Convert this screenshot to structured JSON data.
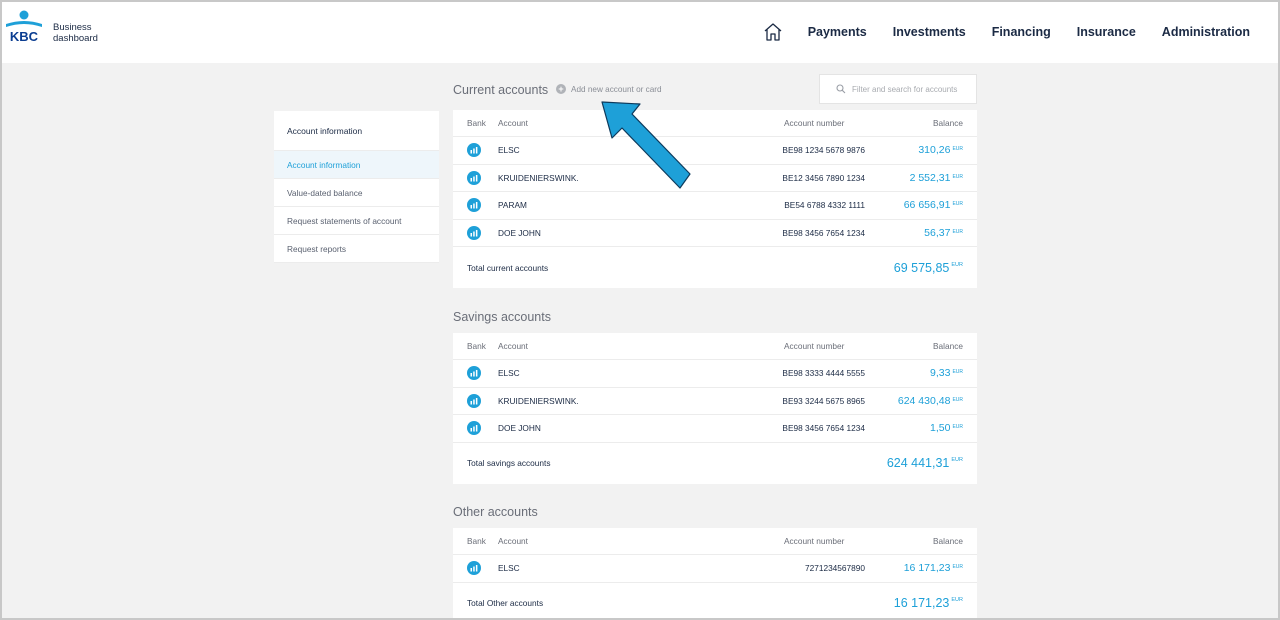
{
  "brand": {
    "name": "KBC",
    "subtitle_line1": "Business",
    "subtitle_line2": "dashboard",
    "color": "#0b3d91"
  },
  "nav": {
    "items": [
      "Payments",
      "Investments",
      "Financing",
      "Insurance",
      "Administration"
    ]
  },
  "sidebar": {
    "title": "Account information",
    "items": [
      {
        "label": "Account information",
        "active": true
      },
      {
        "label": "Value-dated balance"
      },
      {
        "label": "Request statements of account"
      },
      {
        "label": "Request reports"
      }
    ]
  },
  "search": {
    "placeholder": "Filter and search for accounts"
  },
  "columns": {
    "bank": "Bank",
    "account": "Account",
    "number": "Account number",
    "balance": "Balance"
  },
  "currency": "EUR",
  "current": {
    "title": "Current accounts",
    "add_link": "Add new account or card",
    "rows": [
      {
        "account": "ELSC",
        "number": "BE98 1234 5678 9876",
        "balance": "310,26"
      },
      {
        "account": "KRUIDENIERSWINK.",
        "number": "BE12 3456 7890 1234",
        "balance": "2 552,31"
      },
      {
        "account": "PARAM",
        "number": "BE54 6788 4332 1111",
        "balance": "66 656,91"
      },
      {
        "account": "DOE JOHN",
        "number": "BE98 3456 7654 1234",
        "balance": "56,37"
      }
    ],
    "total_label": "Total current accounts",
    "total": "69 575,85"
  },
  "savings": {
    "title": "Savings accounts",
    "rows": [
      {
        "account": "ELSC",
        "number": "BE98 3333 4444 5555",
        "balance": "9,33"
      },
      {
        "account": "KRUIDENIERSWINK.",
        "number": "BE93 3244 5675 8965",
        "balance": "624 430,48"
      },
      {
        "account": "DOE JOHN",
        "number": "BE98 3456 7654 1234",
        "balance": "1,50"
      }
    ],
    "total_label": "Total savings accounts",
    "total": "624 441,31"
  },
  "other": {
    "title": "Other accounts",
    "rows": [
      {
        "account": "ELSC",
        "number": "7271234567890",
        "balance": "16 171,23"
      }
    ],
    "total_label": "Total Other accounts",
    "total": "16 171,23"
  },
  "colors": {
    "accent": "#1ea0d8",
    "navy": "#1b2a44",
    "background": "#f2f2f2"
  }
}
